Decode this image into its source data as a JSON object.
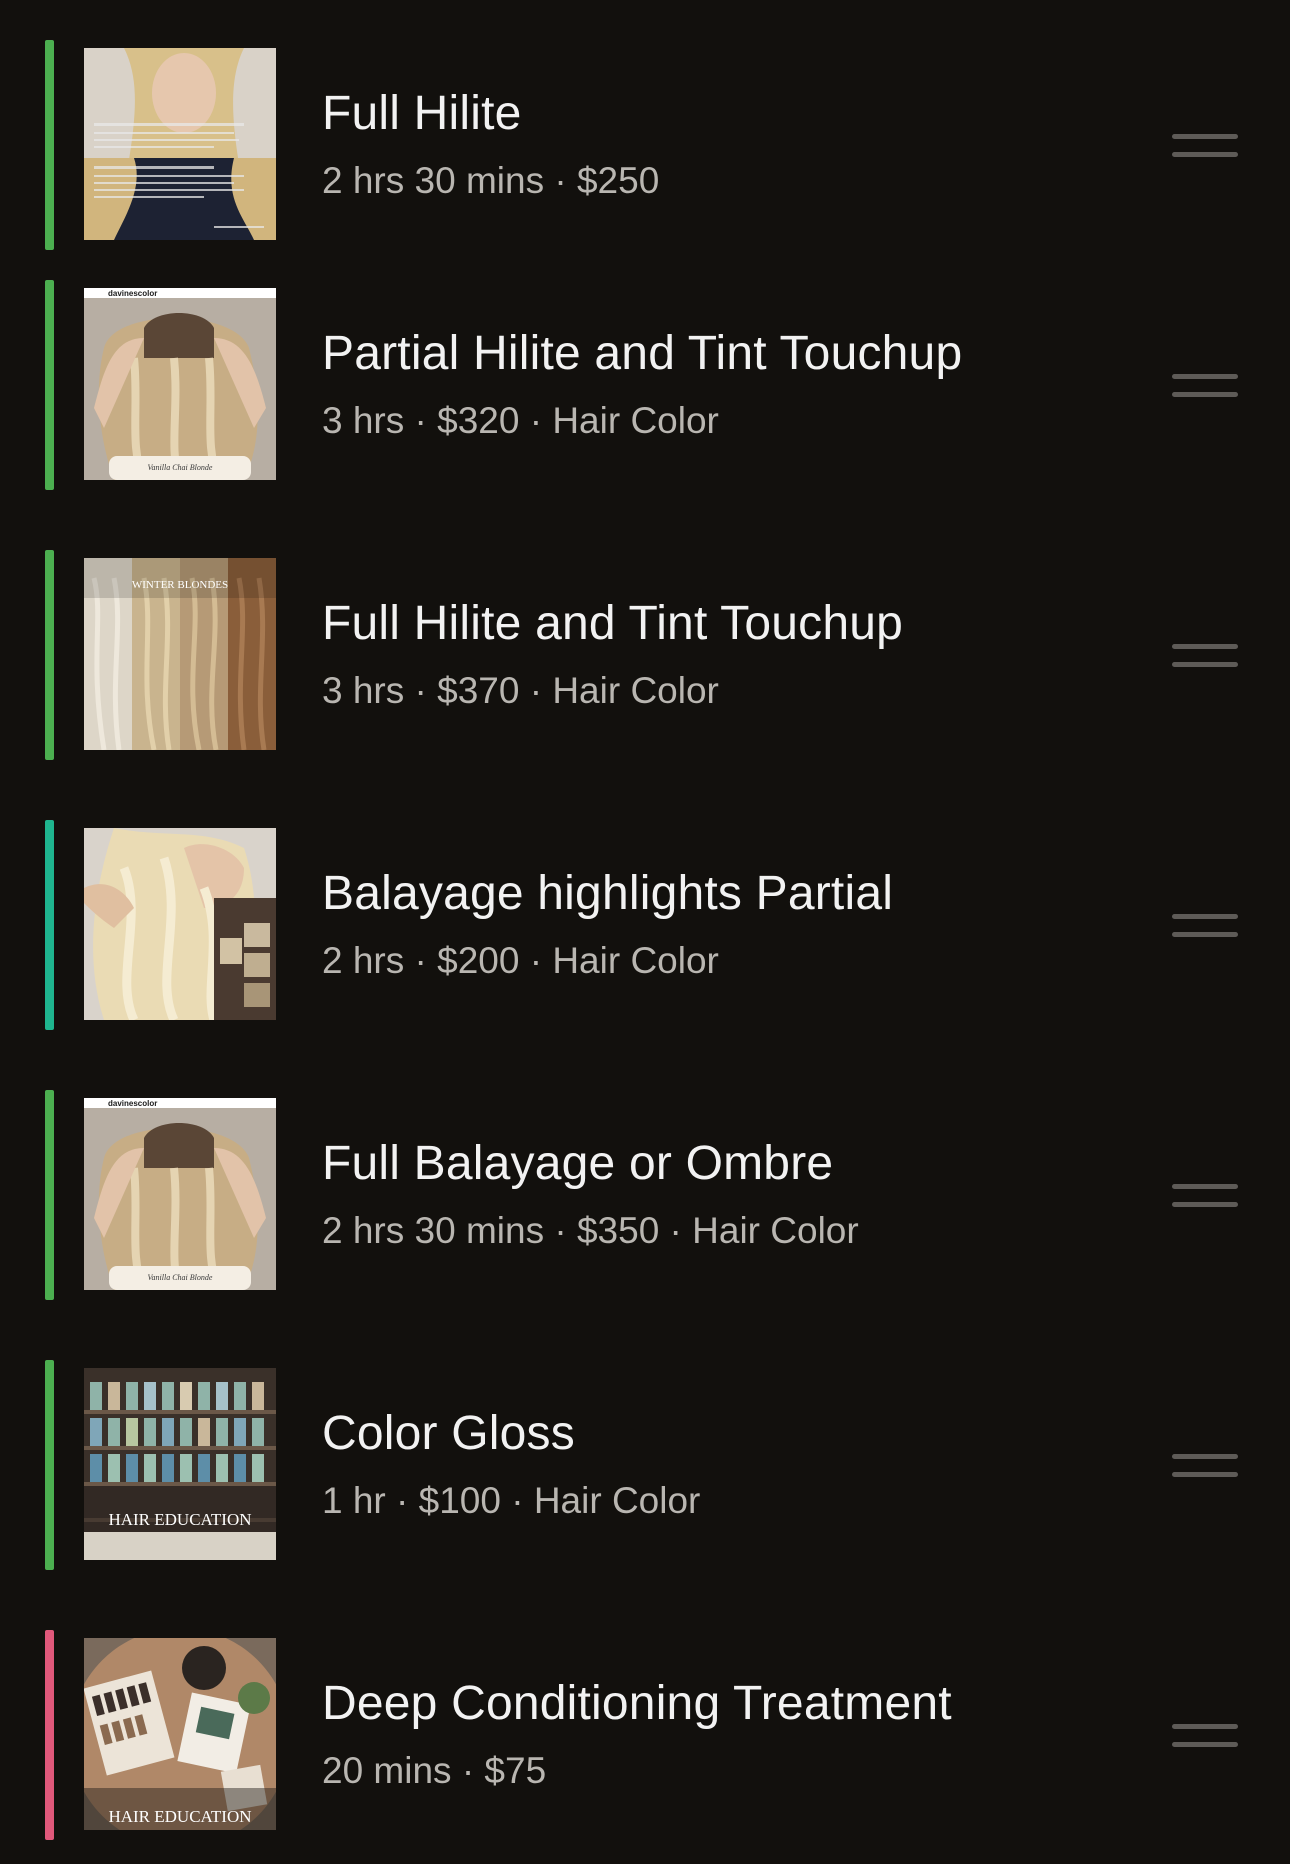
{
  "services": [
    {
      "title": "Full Hilite",
      "subtitle": "2 hrs 30 mins · $250",
      "accent": "#4caf50",
      "image": "blonde-portrait-with-text-photo"
    },
    {
      "title": "Partial Hilite and Tint Touchup",
      "subtitle": "3 hrs · $320 · Hair Color",
      "accent": "#4caf50",
      "image": "balayage-back-view-photo",
      "image_header": "davinescolor",
      "image_caption": "Vanilla Chai Blonde"
    },
    {
      "title": "Full Hilite and Tint Touchup",
      "subtitle": "3 hrs · $370 · Hair Color",
      "accent": "#4caf50",
      "image": "winter-blondes-swatch-photo",
      "image_header": "WINTER BLONDES"
    },
    {
      "title": "Balayage highlights Partial",
      "subtitle": "2 hrs · $200 · Hair Color",
      "accent": "#1fb58f",
      "image": "blonde-hair-with-swatches-photo"
    },
    {
      "title": "Full Balayage or Ombre",
      "subtitle": "2 hrs 30 mins · $350 · Hair Color",
      "accent": "#4caf50",
      "image": "balayage-back-view-photo",
      "image_header": "davinescolor",
      "image_caption": "Vanilla Chai Blonde"
    },
    {
      "title": "Color Gloss",
      "subtitle": "1 hr · $100 · Hair Color",
      "accent": "#4caf50",
      "image": "product-shelf-photo",
      "image_caption": "HAIR EDUCATION"
    },
    {
      "title": "Deep Conditioning Treatment",
      "subtitle": "20 mins · $75",
      "accent": "#e0587a",
      "image": "color-tools-flatlay-photo",
      "image_caption": "HAIR EDUCATION"
    }
  ],
  "handle_icon": "drag-handle-icon"
}
